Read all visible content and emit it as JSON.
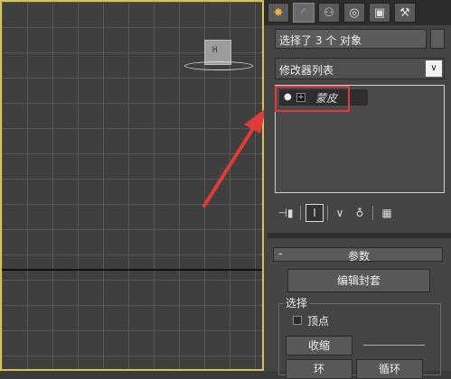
{
  "viewport": {
    "object_label": "H"
  },
  "command_panel": {
    "tabs": [
      {
        "icon": "create-icon",
        "glyph": "✸"
      },
      {
        "icon": "modify-icon",
        "glyph": "◜"
      },
      {
        "icon": "hierarchy-icon",
        "glyph": "⚇"
      },
      {
        "icon": "motion-icon",
        "glyph": "◎"
      },
      {
        "icon": "display-icon",
        "glyph": "▣"
      },
      {
        "icon": "utilities-icon",
        "glyph": "⚒"
      }
    ],
    "selection_name": "选择了 3 个 对象",
    "modifier_list_label": "修改器列表",
    "modifier_list_arrow": "∨",
    "stack_items": [
      {
        "label": "蒙皮",
        "expand": "+"
      }
    ],
    "stack_tool_glyphs": {
      "pin": "⊣▮",
      "show_end": "Ⅰ",
      "make_unique": "∨",
      "remove": "♁",
      "configure": "▦"
    },
    "rollout": {
      "collapse": "-",
      "title": "参数",
      "edit_envelopes": "编辑封套",
      "selection_group": "选择",
      "vertices_label": "顶点",
      "shrink_label": "收缩",
      "ring_label": "环",
      "loop_label": "循环"
    }
  },
  "colors": {
    "viewport_border": "#d6c25a",
    "highlight": "#e03a3a",
    "arrow": "#e03a3a"
  }
}
